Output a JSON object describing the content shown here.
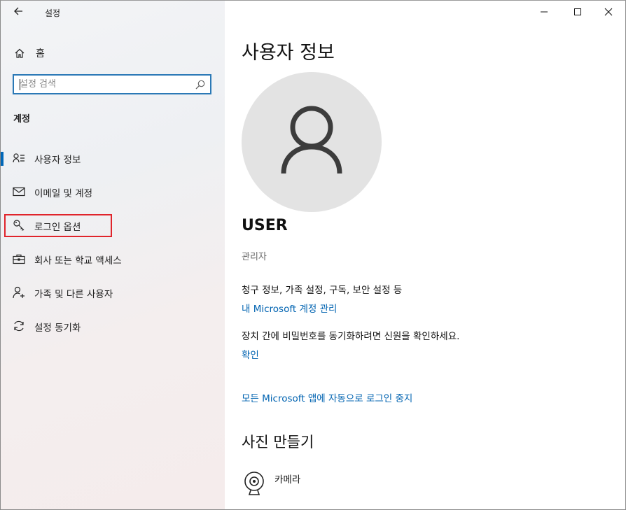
{
  "window": {
    "title": "설정",
    "back_icon": "arrow-left-icon",
    "controls": [
      "minimize-icon",
      "maximize-icon",
      "close-icon"
    ]
  },
  "sidebar": {
    "home": {
      "label": "홈",
      "icon": "home-icon"
    },
    "search": {
      "placeholder": "설정 검색",
      "value": "",
      "icon": "search-icon"
    },
    "section_title": "계정",
    "items": [
      {
        "label": "사용자 정보",
        "icon": "user-info-icon",
        "active": true
      },
      {
        "label": "이메일 및 계정",
        "icon": "mail-icon",
        "active": false
      },
      {
        "label": "로그인 옵션",
        "icon": "key-icon",
        "active": false,
        "highlighted": true
      },
      {
        "label": "회사 또는 학교 액세스",
        "icon": "briefcase-icon",
        "active": false
      },
      {
        "label": "가족 및 다른 사용자",
        "icon": "person-add-icon",
        "active": false
      },
      {
        "label": "설정 동기화",
        "icon": "sync-icon",
        "active": false
      }
    ],
    "accent_color": "#0067b8",
    "highlight_color": "#e0242b"
  },
  "main": {
    "title": "사용자 정보",
    "avatar_icon": "user-avatar-icon",
    "username": "USER",
    "role": "관리자",
    "billing_text": "청구 정보, 가족 설정, 구독, 보안 설정 등",
    "manage_link": "내 Microsoft 계정 관리",
    "sync_text": "장치 간에 비밀번호를 동기화하려면 신원을 확인하세요.",
    "verify_link": "확인",
    "stop_signin_link": "모든 Microsoft 앱에 자동으로 로그인 중지",
    "photo_section_title": "사진 만들기",
    "camera": {
      "label": "카메라",
      "icon": "camera-icon"
    },
    "link_color": "#0063b1"
  }
}
